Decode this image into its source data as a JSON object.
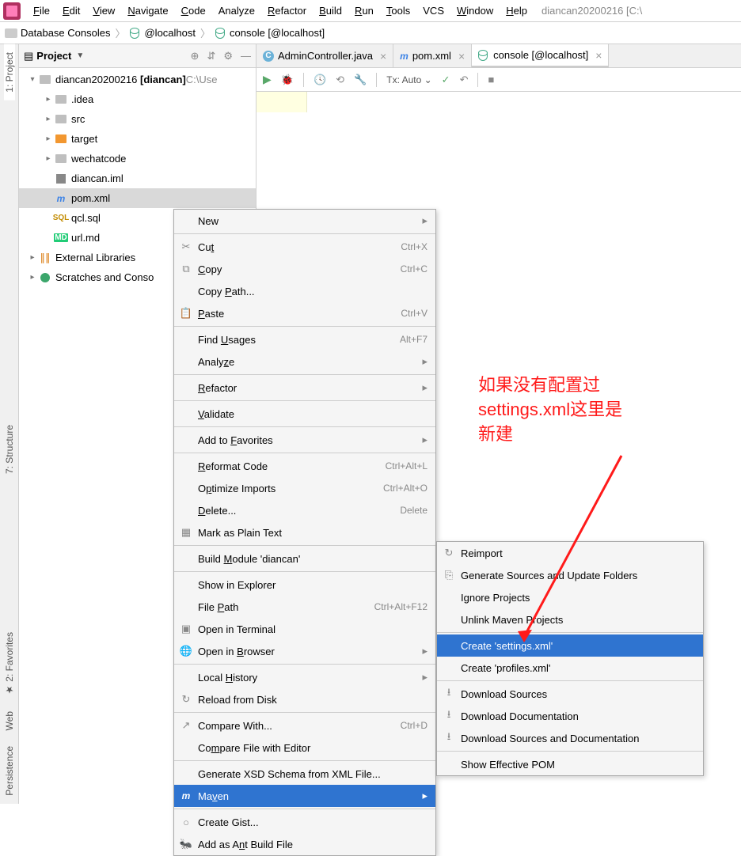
{
  "menu": [
    "File",
    "Edit",
    "View",
    "Navigate",
    "Code",
    "Analyze",
    "Refactor",
    "Build",
    "Run",
    "Tools",
    "VCS",
    "Window",
    "Help"
  ],
  "menu_u": [
    "F",
    "E",
    "V",
    "N",
    "C",
    "",
    "R",
    "B",
    "R",
    "T",
    "",
    "W",
    "H"
  ],
  "project_hint": "diancan20200216 [C:\\",
  "breadcrumb": {
    "a": "Database Consoles",
    "b": "@localhost",
    "c": "console [@localhost]"
  },
  "toolw": {
    "title": "Project"
  },
  "left_tabs": [
    "1: Project",
    "7: Structure",
    "2: Favorites",
    "Web"
  ],
  "left_last": "Persistence",
  "tree": [
    {
      "ind": 0,
      "exp": "▾",
      "ico": "folder",
      "label": "diancan20200216",
      "bold": "[diancan]",
      "suffix": " C:\\Use"
    },
    {
      "ind": 1,
      "exp": "▸",
      "ico": "folder",
      "label": ".idea"
    },
    {
      "ind": 1,
      "exp": "▸",
      "ico": "folder",
      "label": "src"
    },
    {
      "ind": 1,
      "exp": "▸",
      "ico": "folder-o",
      "label": "target"
    },
    {
      "ind": 1,
      "exp": "▸",
      "ico": "folder",
      "label": "wechatcode"
    },
    {
      "ind": 1,
      "exp": "",
      "ico": "iml",
      "label": "diancan.iml"
    },
    {
      "ind": 1,
      "exp": "",
      "ico": "m",
      "label": "pom.xml",
      "sel": true
    },
    {
      "ind": 1,
      "exp": "",
      "ico": "sql",
      "label": "qcl.sql"
    },
    {
      "ind": 1,
      "exp": "",
      "ico": "md",
      "label": "url.md"
    },
    {
      "ind": 0,
      "exp": "▸",
      "ico": "lib",
      "label": "External Libraries"
    },
    {
      "ind": 0,
      "exp": "▸",
      "ico": "scr",
      "label": "Scratches and Conso"
    }
  ],
  "tabs": [
    {
      "ico": "c",
      "label": "AdminController.java"
    },
    {
      "ico": "m",
      "label": "pom.xml"
    },
    {
      "ico": "db",
      "label": "console [@localhost]",
      "active": true
    }
  ],
  "tx": "Tx: Auto",
  "ctx1": [
    {
      "label": "New",
      "sub": true
    },
    {
      "sep": 1
    },
    {
      "label": "Cut",
      "ico": "✂",
      "sc": "Ctrl+X",
      "u": 2
    },
    {
      "label": "Copy",
      "ico": "⧉",
      "sc": "Ctrl+C",
      "u": 0
    },
    {
      "label": "Copy Path...",
      "u": 5
    },
    {
      "label": "Paste",
      "ico": "📋",
      "sc": "Ctrl+V",
      "u": 0
    },
    {
      "sep": 1
    },
    {
      "label": "Find Usages",
      "sc": "Alt+F7",
      "u": 5
    },
    {
      "label": "Analyze",
      "sub": true,
      "u": 5
    },
    {
      "sep": 1
    },
    {
      "label": "Refactor",
      "sub": true,
      "u": 0
    },
    {
      "sep": 1
    },
    {
      "label": "Validate",
      "u": 0
    },
    {
      "sep": 1
    },
    {
      "label": "Add to Favorites",
      "sub": true,
      "u": 7
    },
    {
      "sep": 1
    },
    {
      "label": "Reformat Code",
      "sc": "Ctrl+Alt+L",
      "u": 0
    },
    {
      "label": "Optimize Imports",
      "sc": "Ctrl+Alt+O",
      "u": 1
    },
    {
      "label": "Delete...",
      "sc": "Delete",
      "u": 0
    },
    {
      "label": "Mark as Plain Text",
      "ico": "▦"
    },
    {
      "sep": 1
    },
    {
      "label": "Build Module 'diancan'",
      "u": 6
    },
    {
      "sep": 1
    },
    {
      "label": "Show in Explorer"
    },
    {
      "label": "File Path",
      "sc": "Ctrl+Alt+F12",
      "u": 5
    },
    {
      "label": "Open in Terminal",
      "ico": "▣"
    },
    {
      "label": "Open in Browser",
      "sub": true,
      "ico": "🌐",
      "u": 8
    },
    {
      "sep": 1
    },
    {
      "label": "Local History",
      "sub": true,
      "u": 6
    },
    {
      "label": "Reload from Disk",
      "ico": "↻"
    },
    {
      "sep": 1
    },
    {
      "label": "Compare With...",
      "ico": "↗",
      "sc": "Ctrl+D"
    },
    {
      "label": "Compare File with Editor",
      "u": 2
    },
    {
      "sep": 1
    },
    {
      "label": "Generate XSD Schema from XML File..."
    },
    {
      "label": "Maven",
      "hl": true,
      "ico": "m",
      "sub": true,
      "u": 2
    },
    {
      "sep": 1
    },
    {
      "label": "Create Gist...",
      "ico": "○"
    },
    {
      "label": "Add as Ant Build File",
      "ico": "🐜",
      "u": 8
    }
  ],
  "ctx2": [
    {
      "label": "Reimport",
      "ico": "↻"
    },
    {
      "label": "Generate Sources and Update Folders",
      "ico": "⎘"
    },
    {
      "label": "Ignore Projects"
    },
    {
      "label": "Unlink Maven Projects"
    },
    {
      "sep": 1
    },
    {
      "label": "Create 'settings.xml'",
      "hl": true
    },
    {
      "label": "Create 'profiles.xml'"
    },
    {
      "sep": 1
    },
    {
      "label": "Download Sources",
      "ico": "⭳"
    },
    {
      "label": "Download Documentation",
      "ico": "⭳"
    },
    {
      "label": "Download Sources and Documentation",
      "ico": "⭳"
    },
    {
      "sep": 1
    },
    {
      "label": "Show Effective POM"
    }
  ],
  "ann": "如果没有配置过\nsettings.xml这里是\n新建"
}
